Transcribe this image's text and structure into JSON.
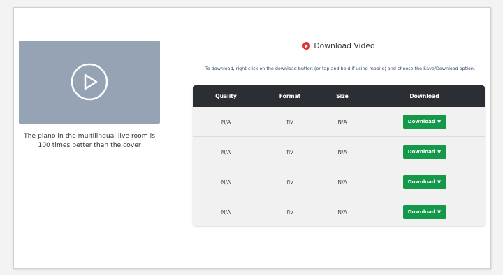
{
  "video": {
    "caption": "The piano in the multilingual live room is 100 times better than the cover",
    "thumbnail_color": "#96a3b4"
  },
  "header": {
    "title": "Download Video",
    "icon": "play-circle-icon",
    "icon_color": "#e1323a"
  },
  "instructions": "To download, right-click on the download button (or tap and hold if using mobile) and choose the Save/Download option.",
  "table": {
    "columns": [
      "Quality",
      "Format",
      "Size",
      "Download"
    ],
    "rows": [
      {
        "quality": "N/A",
        "format": "flv",
        "size": "N/A",
        "button": "Download"
      },
      {
        "quality": "N/A",
        "format": "flv",
        "size": "N/A",
        "button": "Download"
      },
      {
        "quality": "N/A",
        "format": "flv",
        "size": "N/A",
        "button": "Download"
      },
      {
        "quality": "N/A",
        "format": "flv",
        "size": "N/A",
        "button": "Download"
      }
    ],
    "header_color": "#2b2e33",
    "button_color": "#14994a"
  }
}
